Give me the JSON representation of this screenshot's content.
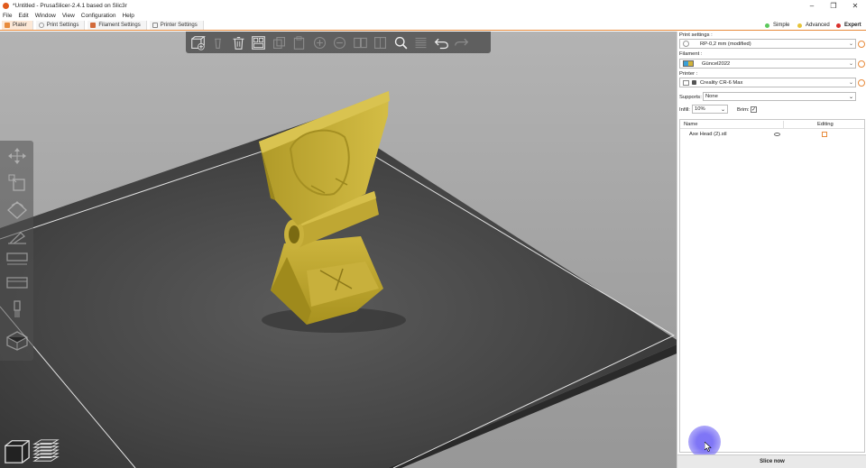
{
  "window": {
    "title": "*Untitled - PrusaSlicer-2.4.1 based on Slic3r",
    "controls": [
      "–",
      "❐",
      "✕"
    ]
  },
  "menu": [
    "File",
    "Edit",
    "Window",
    "View",
    "Configuration",
    "Help"
  ],
  "tabs": [
    {
      "label": "Plater",
      "icon_color": "#e88b3c",
      "active": true
    },
    {
      "label": "Print Settings",
      "icon_color": "#9a9a9a",
      "active": false
    },
    {
      "label": "Filament Settings",
      "icon_color": "#d26a3a",
      "active": false
    },
    {
      "label": "Printer Settings",
      "icon_color": "#9a9a9a",
      "active": false
    }
  ],
  "modes": [
    {
      "label": "Simple",
      "color": "#5cc85c"
    },
    {
      "label": "Advanced",
      "color": "#e6c43a"
    },
    {
      "label": "Expert",
      "color": "#d9302c"
    }
  ],
  "top_toolbar": [
    "add-icon",
    "delete-icon",
    "delete-all-icon",
    "arrange-icon",
    "copy-icon",
    "paste-icon",
    "add-instance-icon",
    "remove-instance-icon",
    "split-objects-icon",
    "split-parts-icon",
    "search-icon",
    "layers-editing-icon",
    "undo-icon",
    "redo-icon"
  ],
  "left_toolbar": [
    "move-icon",
    "scale-icon",
    "rotate-icon",
    "place-on-face-icon",
    "cut-icon",
    "hollow-icon",
    "support-paint-icon",
    "seam-paint-icon"
  ],
  "sidebar": {
    "print_settings_label": "Print settings :",
    "print_settings_value": "RP-0,2 mm (modified)",
    "filament_label": "Filament :",
    "filament_value": "Güncel2022",
    "printer_label": "Printer :",
    "printer_value": "Creality CR-6 Max",
    "supports_label": "Supports:",
    "supports_value": "None",
    "infill_label": "Infill:",
    "infill_value": "10%",
    "brim_label": "Brim:",
    "brim_checked": true,
    "objects_header_name": "Name",
    "objects_header_editing": "Editing",
    "objects": [
      {
        "name": "Axe Head (2).stl"
      }
    ],
    "slice_label": "Slice now"
  },
  "colors": {
    "accent": "#e88b3c",
    "model": "#c8b040",
    "bed": "#4a4a4a"
  }
}
